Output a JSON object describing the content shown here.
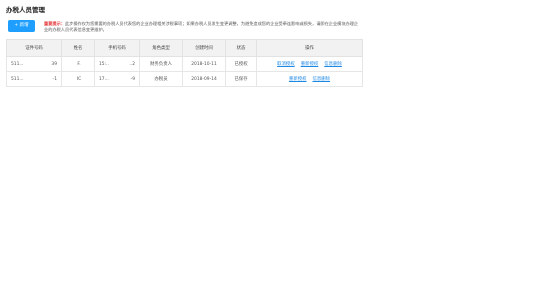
{
  "page": {
    "title": "办税人员管理"
  },
  "toolbar": {
    "add_label": "+ 新增"
  },
  "notice": {
    "label": "重要提示：",
    "text": "此步操作仅为您需要的办税人员代表您的企业办理相关涉税事项；如果办税人员发生变更调整，为避免造成您的企业受牵连影响或损失，请即在企业模块办理企业的办税人员代表信息变更维护。"
  },
  "table": {
    "headers": [
      "证件号码",
      "姓名",
      "手机号码",
      "角色类型",
      "创建时间",
      "状态",
      "操作"
    ],
    "rows": [
      {
        "id_prefix": "511...",
        "id_suffix": "39",
        "name": "F.",
        "phone_prefix": "15:..",
        "phone_suffix": "..2",
        "role": "财务负责人",
        "created": "2018-10-11",
        "status": "已授权",
        "actions": [
          "取消授权",
          "重新授权",
          "信息删除"
        ]
      },
      {
        "id_prefix": "511...",
        "id_suffix": "-1",
        "name": "IC",
        "phone_prefix": "17...",
        "phone_suffix": "-9",
        "role": "办税员",
        "created": "2018-09-14",
        "status": "已保存",
        "actions": [
          "重新授权",
          "信息删除"
        ]
      }
    ]
  }
}
